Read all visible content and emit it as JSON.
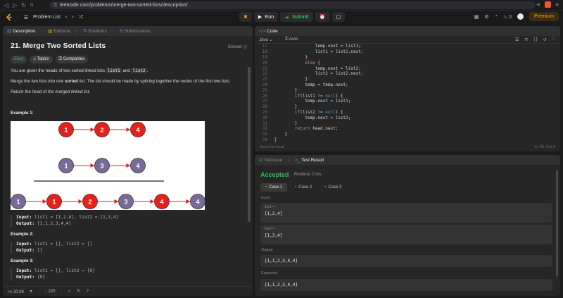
{
  "browser": {
    "url": "leetcode.com/problems/merge-two-sorted-lists/description/"
  },
  "appbar": {
    "problem_list": "Problem List",
    "run": "Run",
    "submit": "Submit",
    "streak": "0",
    "premium": "Premium"
  },
  "desc_tabs": [
    "Description",
    "Editorial",
    "Solutions",
    "Submissions"
  ],
  "problem": {
    "title": "21. Merge Two Sorted Lists",
    "solved": "Solved",
    "tags": [
      "Easy",
      "Topics",
      "Companies"
    ],
    "p1_a": "You are given the heads of two sorted linked lists ",
    "p1_c1": "list1",
    "p1_b": " and ",
    "p1_c2": "list2",
    "p1_d": ".",
    "p2_a": "Merge the two lists into one ",
    "p2_bold": "sorted",
    "p2_b": " list. The list should be made by splicing together the nodes of the first two lists.",
    "p3": "Return the head of the merged linked list.",
    "diagram": {
      "row1": [
        "1",
        "2",
        "4"
      ],
      "row2": [
        "1",
        "3",
        "4"
      ],
      "row3": [
        "1",
        "1",
        "2",
        "3",
        "4",
        "4"
      ],
      "red": "#e8201a",
      "purple": "#7a6a99"
    },
    "examples": [
      {
        "title": "Example 1:",
        "input_label": "Input:",
        "input": "list1 = [1,2,4], list2 = [1,3,4]",
        "output_label": "Output:",
        "output": "[1,1,2,3,4,4]"
      },
      {
        "title": "Example 2:",
        "input_label": "Input:",
        "input": "list1 = [], list2 = []",
        "output_label": "Output:",
        "output": "[]"
      },
      {
        "title": "Example 3:",
        "input_label": "Input:",
        "input": "list1 = [], list2 = [0]",
        "output_label": "Output:",
        "output": "[0]"
      }
    ]
  },
  "desc_footer": {
    "likes": "20.9K",
    "comments": "220"
  },
  "code_panel": {
    "tab": "Code",
    "language": "Java",
    "mode": "Auto",
    "status": "Saved to local",
    "position": "Ln 33, Col 9",
    "lines": [
      {
        "n": "17",
        "t": "                temp.next = list1;"
      },
      {
        "n": "18",
        "t": "                list1 = list1.next;"
      },
      {
        "n": "19",
        "t": "            }"
      },
      {
        "n": "20",
        "t": "            else {"
      },
      {
        "n": "21",
        "t": "                temp.next = list2;"
      },
      {
        "n": "22",
        "t": "                list2 = list2.next;"
      },
      {
        "n": "23",
        "t": "            }"
      },
      {
        "n": "24",
        "t": "            temp = temp.next;"
      },
      {
        "n": "25",
        "t": "        }"
      },
      {
        "n": "26",
        "t": "        if(list1 != null) {"
      },
      {
        "n": "27",
        "t": "            temp.next = list1;"
      },
      {
        "n": "28",
        "t": "        }"
      },
      {
        "n": "29",
        "t": "        if(list2 != null) {"
      },
      {
        "n": "30",
        "t": "            temp.next = list2;"
      },
      {
        "n": "31",
        "t": "        }"
      },
      {
        "n": "32",
        "t": "        return head.next;"
      },
      {
        "n": "33",
        "t": "    }"
      },
      {
        "n": "34",
        "t": "}"
      }
    ]
  },
  "result_panel": {
    "tabs": [
      "Testcase",
      "Test Result"
    ],
    "accepted": "Accepted",
    "runtime": "Runtime: 0 ms",
    "cases": [
      "Case 1",
      "Case 2",
      "Case 3"
    ],
    "input_label": "Input",
    "var1": "list1 =",
    "val1": "[1,2,4]",
    "var2": "list2 =",
    "val2": "[1,3,4]",
    "output_label": "Output",
    "output": "[1,1,2,3,4,4]",
    "expected_label": "Expected",
    "expected": "[1,1,2,3,4,4]"
  }
}
